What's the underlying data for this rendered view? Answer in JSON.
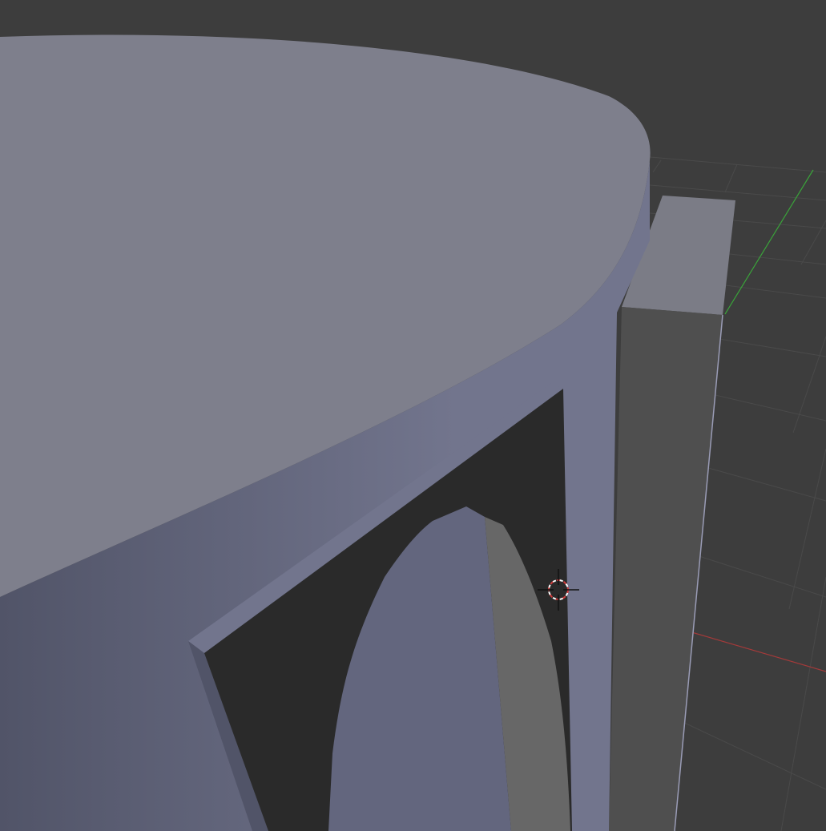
{
  "app": "3D Viewport",
  "colors": {
    "background": "#3d3d3d",
    "grid_line": "#4a4a4a",
    "axis_x": "#a33a3a",
    "axis_y": "#3aa33a",
    "top_face": "#7e7f8c",
    "side_face_light": "#72758d",
    "side_face_dark": "#515468",
    "arch_interior": "#2a2a2a",
    "arch_inner_face": "#63667e",
    "arch_inner_grey": "#676767",
    "bar_top": "#7b7c86",
    "bar_front": "#4f4f4f",
    "cursor_red": "#d23a3a",
    "cursor_white": "#ffffff"
  },
  "objects": [
    {
      "name": "cylinder",
      "description_icon": "mesh-icon"
    },
    {
      "name": "arch-opening",
      "description_icon": "mesh-icon"
    },
    {
      "name": "rectangular-bar",
      "description_icon": "mesh-icon"
    }
  ],
  "cursor": {
    "icon": "3d-cursor-icon"
  }
}
